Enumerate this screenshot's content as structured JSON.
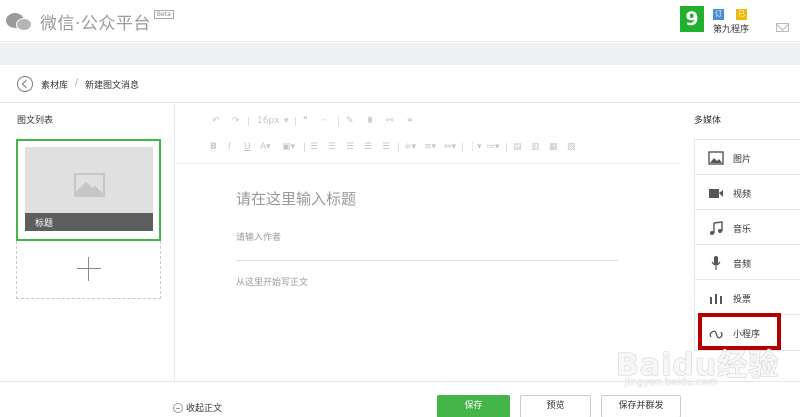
{
  "header": {
    "brand": "微信·公众平台",
    "beta": "Beta",
    "account": {
      "avatar_text": "9",
      "subscription_tag": "订阅号",
      "verified_tag": "已认证",
      "name": "第九程序"
    }
  },
  "breadcrumb": {
    "parent": "素材库",
    "separator": "/",
    "current": "新建图文消息"
  },
  "left": {
    "title": "图文列表",
    "card_title": "标题"
  },
  "toolbar": {
    "font_size": "16px"
  },
  "editor": {
    "title_placeholder": "请在这里输入标题",
    "author_placeholder": "请输入作者",
    "content_placeholder": "从这里开始写正文"
  },
  "right": {
    "title": "多媒体",
    "items": [
      {
        "label": "图片",
        "icon": "image-icon"
      },
      {
        "label": "视频",
        "icon": "video-icon"
      },
      {
        "label": "音乐",
        "icon": "music-icon"
      },
      {
        "label": "音频",
        "icon": "mic-icon"
      },
      {
        "label": "投票",
        "icon": "vote-icon"
      },
      {
        "label": "小程序",
        "icon": "mini-program-icon"
      }
    ]
  },
  "footer": {
    "collapse": "收起正文",
    "save": "保存",
    "preview": "预览",
    "publish": "保存并群发"
  },
  "watermark": {
    "main": "Baidu经验",
    "sub": "jingyan.baidu.com"
  },
  "colors": {
    "accent": "#44b549",
    "highlight": "#b50000",
    "tag_blue": "#4a8ed8",
    "tag_yellow": "#f0b90b"
  }
}
